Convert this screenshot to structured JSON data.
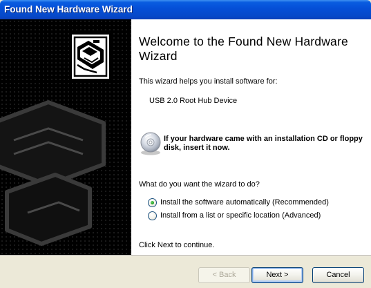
{
  "window": {
    "title": "Found New Hardware Wizard"
  },
  "wizard": {
    "heading": "Welcome to the Found New Hardware Wizard",
    "intro": "This wizard helps you install software for:",
    "device_name": "USB 2.0 Root Hub Device",
    "cd_prompt": "If your hardware came with an installation CD or floppy disk, insert it now.",
    "question": "What do you want the wizard to do?",
    "options": [
      {
        "label": "Install the software automatically (Recommended)",
        "selected": true
      },
      {
        "label": "Install from a list or specific location (Advanced)",
        "selected": false
      }
    ],
    "continue_text": "Click Next to continue."
  },
  "buttons": {
    "back_label": "< Back",
    "next_label": "Next >",
    "cancel_label": "Cancel"
  },
  "icons": {
    "hardware": "hardware-wizard-icon",
    "cd": "cd-disk-icon"
  },
  "colors": {
    "title_bar": "#0550d8",
    "dialog_bg": "#ece9d8",
    "radio_dot": "#23a223"
  }
}
